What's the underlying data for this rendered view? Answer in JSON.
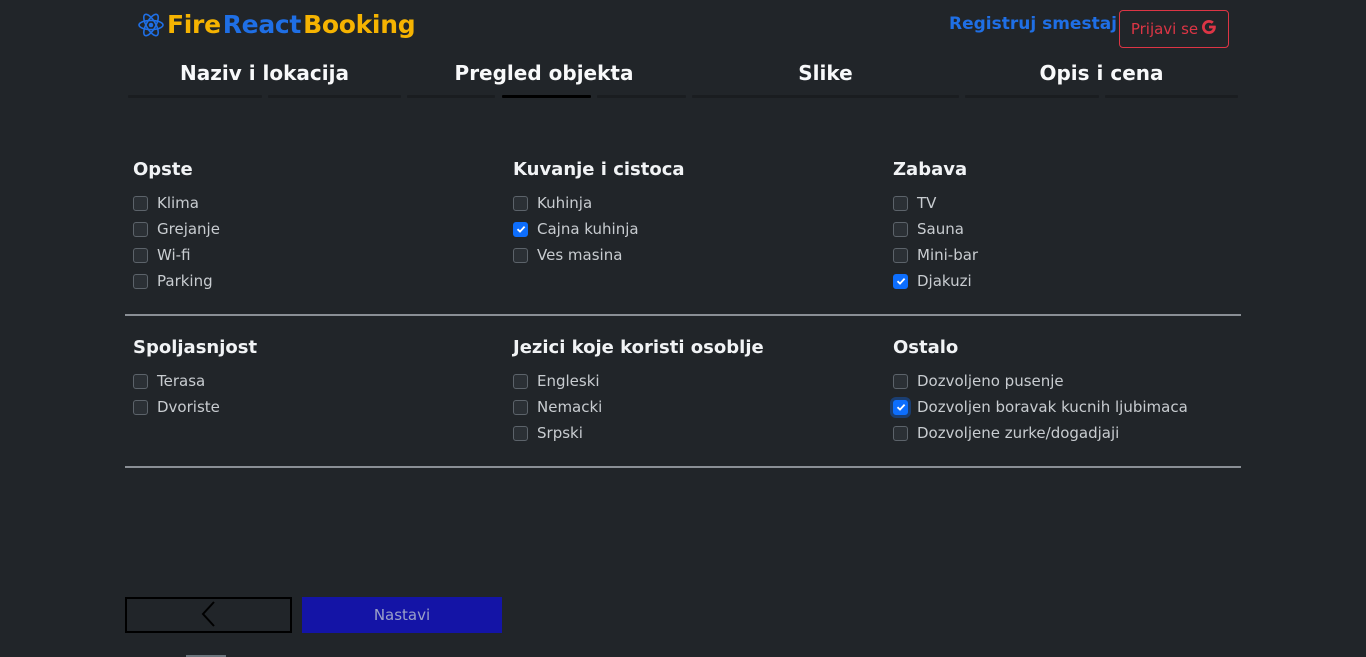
{
  "header": {
    "brand": {
      "part1": "Fire",
      "part2": "React",
      "part3": "Booking",
      "icon": "react-atom-icon"
    },
    "register_label": "Registruj smestaj",
    "login_label": "Prijavi se",
    "login_icon": "google-icon"
  },
  "steps": [
    {
      "label": "Naziv i lokacija"
    },
    {
      "label": "Pregled objekta"
    },
    {
      "label": "Slike"
    },
    {
      "label": "Opis i cena"
    }
  ],
  "groups": [
    {
      "title": "Opste",
      "items": [
        {
          "label": "Klima",
          "checked": false
        },
        {
          "label": "Grejanje",
          "checked": false
        },
        {
          "label": "Wi-fi",
          "checked": false
        },
        {
          "label": "Parking",
          "checked": false
        }
      ]
    },
    {
      "title": "Kuvanje i cistoca",
      "items": [
        {
          "label": "Kuhinja",
          "checked": false
        },
        {
          "label": "Cajna kuhinja",
          "checked": true
        },
        {
          "label": "Ves masina",
          "checked": false
        }
      ]
    },
    {
      "title": "Zabava",
      "items": [
        {
          "label": "TV",
          "checked": false
        },
        {
          "label": "Sauna",
          "checked": false
        },
        {
          "label": "Mini-bar",
          "checked": false
        },
        {
          "label": "Djakuzi",
          "checked": true
        }
      ]
    },
    {
      "title": "Spoljasnjost",
      "items": [
        {
          "label": "Terasa",
          "checked": false
        },
        {
          "label": "Dvoriste",
          "checked": false
        }
      ]
    },
    {
      "title": "Jezici koje koristi osoblje",
      "items": [
        {
          "label": "Engleski",
          "checked": false
        },
        {
          "label": "Nemacki",
          "checked": false
        },
        {
          "label": "Srpski",
          "checked": false
        }
      ]
    },
    {
      "title": "Ostalo",
      "items": [
        {
          "label": "Dozvoljeno pusenje",
          "checked": false
        },
        {
          "label": "Dozvoljen boravak kucnih ljubimaca",
          "checked": true
        },
        {
          "label": "Dozvoljene zurke/dogadjaji",
          "checked": false
        }
      ]
    }
  ],
  "footer": {
    "back_icon": "chevron-left-icon",
    "next_label": "Nastavi"
  },
  "colors": {
    "background": "#212529",
    "brand_yellow": "#f5b301",
    "brand_blue": "#1f6fe5",
    "login_red": "#dc3545",
    "checkbox_blue": "#0d6efd",
    "next_button": "#1414a6"
  }
}
